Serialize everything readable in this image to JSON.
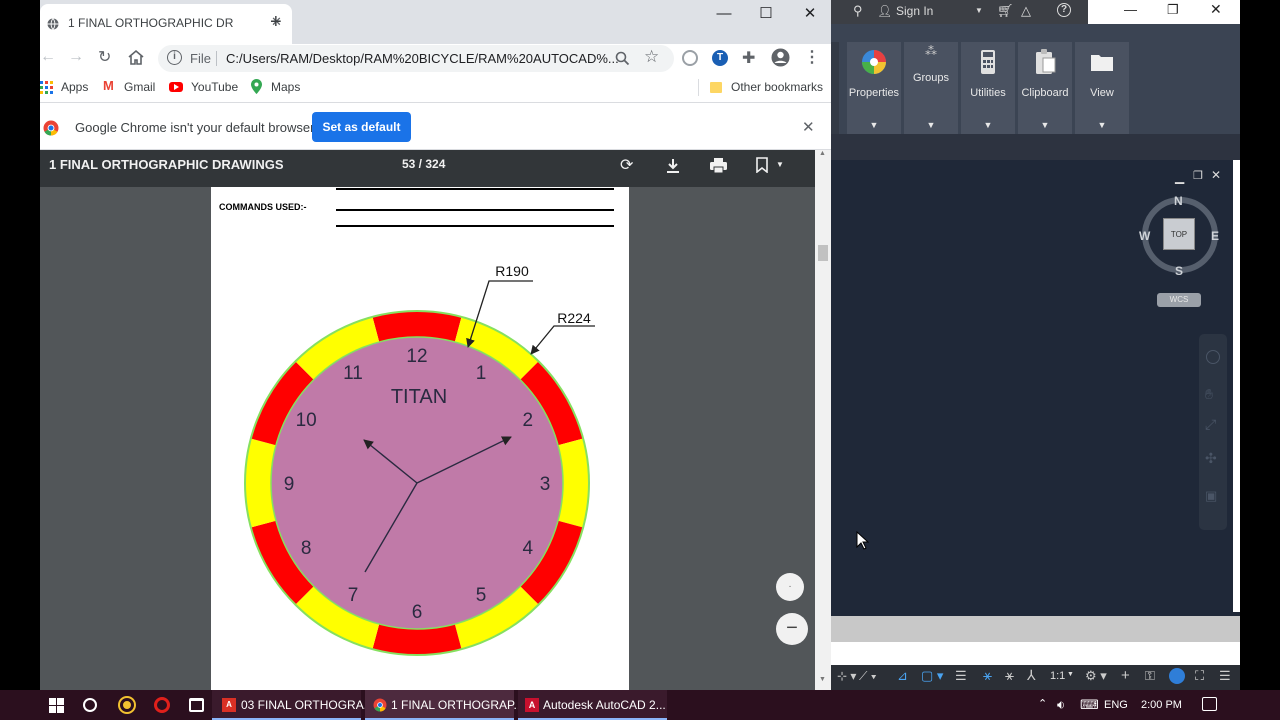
{
  "chrome": {
    "tab_title": "1 FINAL ORTHOGRAPHIC DRAWI…",
    "new_tab": "+",
    "url_scheme": "File",
    "url": "C:/Users/RAM/Desktop/RAM%20BICYCLE/RAM%20AUTOCAD%...",
    "bookmarks": [
      "Apps",
      "Gmail",
      "YouTube",
      "Maps"
    ],
    "other_bookmarks": "Other bookmarks",
    "infobar_text": "Google Chrome isn't your default browser",
    "set_default": "Set as default"
  },
  "pdf": {
    "title": "1 FINAL ORTHOGRAPHIC DRAWINGS",
    "page_counter": "53 / 324",
    "commands_label": "COMMANDS USED:-",
    "clock_brand": "TITAN",
    "radius_inner": "R190",
    "radius_outer": "R224",
    "clock_numbers": [
      "12",
      "1",
      "2",
      "3",
      "4",
      "5",
      "6",
      "7",
      "8",
      "9",
      "10",
      "11"
    ],
    "colors": {
      "red": "#ff0000",
      "yellow": "#ffff00",
      "face": "#c07aa8",
      "rim": "#86e060"
    }
  },
  "autocad": {
    "sign_in": "Sign In",
    "ribbon": [
      "Properties",
      "Groups",
      "Utilities",
      "Clipboard",
      "View"
    ],
    "viewcube": {
      "n": "N",
      "s": "S",
      "e": "E",
      "w": "W",
      "top": "TOP",
      "wcs": "WCS"
    },
    "scale": "1:1",
    "lang": "ENG"
  },
  "taskbar": {
    "items": [
      "03 FINAL ORTHOGRA...",
      "1 FINAL ORTHOGRAP...",
      "Autodesk AutoCAD 2..."
    ],
    "time": "2:00 PM"
  }
}
